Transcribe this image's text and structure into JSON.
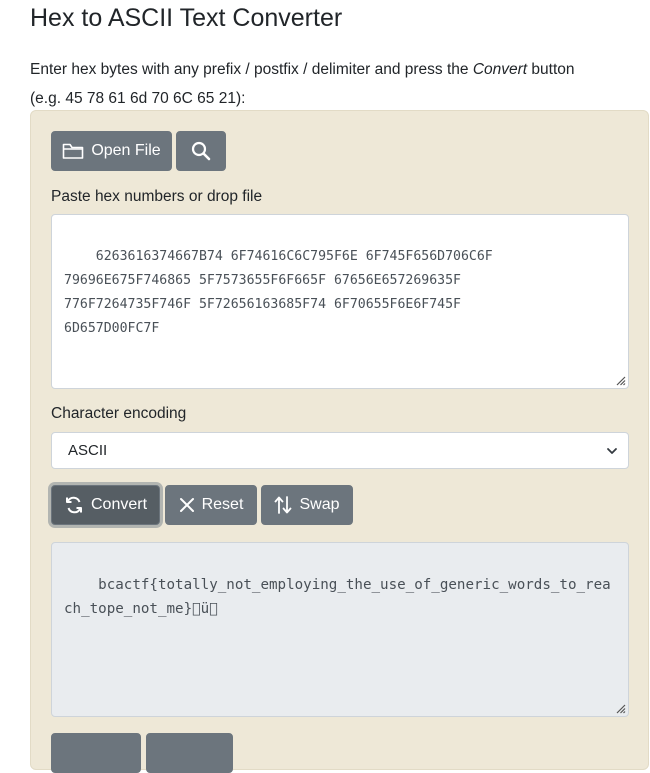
{
  "page": {
    "title": "Hex to ASCII Text Converter",
    "intro_line1_prefix": "Enter hex bytes with any prefix / postfix / delimiter and press the ",
    "intro_line1_em": "Convert",
    "intro_line1_suffix": " button",
    "intro_line2": "(e.g. 45 78 61 6d 70 6C 65 21):"
  },
  "toolbar": {
    "open_file_label": "Open File",
    "open_file_icon": "folder-icon",
    "search_icon": "search-icon"
  },
  "input": {
    "label": "Paste hex numbers or drop file",
    "value": "6263616374667B74 6F74616C6C795F6E 6F745F656D706C6F\n79696E675F746865 5F7573655F6F665F 67656E657269635F\n776F7264735F746F 5F72656163685F74 6F70655F6E6F745F\n6D657D00FC7F"
  },
  "encoding": {
    "label": "Character encoding",
    "selected": "ASCII"
  },
  "actions": {
    "convert_label": "Convert",
    "reset_label": "Reset",
    "swap_label": "Swap"
  },
  "output": {
    "value": "bcactf{totally_not_employing_the_use_of_generic_words_to_reach_tope_not_me}\u0000ü"
  },
  "colors": {
    "panel_bg": "#eee8d7",
    "button_bg": "#6c757d",
    "readonly_bg": "#e9ecef"
  }
}
